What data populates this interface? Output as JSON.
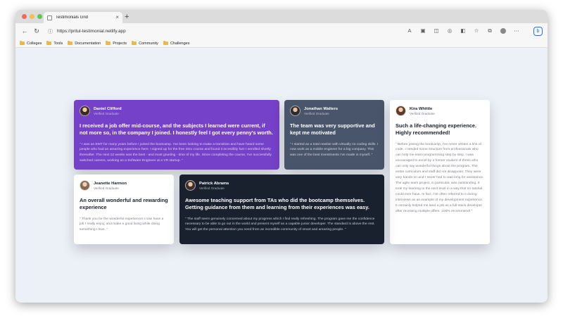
{
  "browser": {
    "tab_title": "Testimonials Grid",
    "url": "https://pritul-testimonial.netlify.app",
    "bookmarks": [
      "Colleges",
      "Tools",
      "Documentation",
      "Projects",
      "Community",
      "Challenges"
    ],
    "colors": {
      "close": "#ed6a5e",
      "minimize": "#f5bf4f",
      "maximize": "#61c554"
    }
  },
  "testimonials": [
    {
      "name": "Daniel Clifford",
      "role": "Verified Graduate",
      "headline": "I received a job offer mid-course, and the subjects I learned were current, if not more so, in the company I joined. I honestly feel I got every penny's worth.",
      "body": "“ I was an EMT for many years before I joined the bootcamp. I've been looking to make a transition and have heard some people who had an amazing experience here. I signed up for the free intro course and found it incredibly fun! I enrolled shortly thereafter. The next 12 weeks was the best - and most grueling - time of my life. Since completing the course, I've successfully switched careers, working as a Software Engineer at a VR startup. ”",
      "bg": "#7541c8"
    },
    {
      "name": "Jonathan Walters",
      "role": "Verified Graduate",
      "headline": "The team was very supportive and kept me motivated",
      "body": "“ I started as a total newbie with virtually no coding skills. I now work as a mobile engineer for a big company. This was one of the best investments I've made in myself. ”",
      "bg": "#48556a"
    },
    {
      "name": "Kira Whittle",
      "role": "Verified Graduate",
      "headline": "Such a life-changing experience. Highly recommended!",
      "body": "“ Before joining the bootcamp, I've never written a line of code. I needed some structure from professionals who can help me learn programming step by step. I was encouraged to enroll by a former student of theirs who can only say wonderful things about the program. The entire curriculum and staff did not disappoint. They were very hands-on and I never had to wait long for assistance. The agile team project, in particular, was outstanding. It took my learning to the next level in a way that no tutorial could ever have. In fact, I've often referred to it during interviews as an example of my development experience. It certainly helped me land a job as a full-stack developer after receiving multiple offers. 100% recommend! ”",
      "bg": "#ffffff"
    },
    {
      "name": "Jeanette Harmon",
      "role": "Verified Graduate",
      "headline": "An overall wonderful and rewarding experience",
      "body": "“ Thank you for the wonderful experience! I now have a job I really enjoy, and make a good living while doing something I love. ”",
      "bg": "#ffffff"
    },
    {
      "name": "Patrick Abrams",
      "role": "Verified Graduate",
      "headline": "Awesome teaching support from TAs who did the bootcamp themselves. Getting guidance from them and learning from their experiences was easy.",
      "body": "“ The staff seem genuinely concerned about my progress which I find really refreshing. The program gave me the confidence necessary to be able to go out in the world and present myself as a capable junior developer. The standard is above the rest. You will get the personal attention you need from an incredible community of smart and amazing people. ”",
      "bg": "#19212e"
    }
  ]
}
